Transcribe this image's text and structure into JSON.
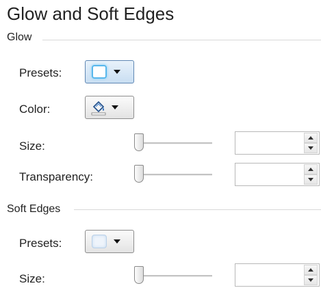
{
  "panel": {
    "title": "Glow and Soft Edges",
    "glow": {
      "section_label": "Glow",
      "presets_label": "Presets:",
      "presets_icon": "glow-preset-icon",
      "color_label": "Color:",
      "color_icon": "paint-bucket-icon",
      "size_label": "Size:",
      "size_value": "",
      "transparency_label": "Transparency:",
      "transparency_value": ""
    },
    "soft_edges": {
      "section_label": "Soft Edges",
      "presets_label": "Presets:",
      "presets_icon": "soft-edge-preset-icon",
      "size_label": "Size:",
      "size_value": ""
    }
  },
  "colors": {
    "glow_accent": "#58b7ec",
    "section_rule": "#d9d9d9"
  }
}
